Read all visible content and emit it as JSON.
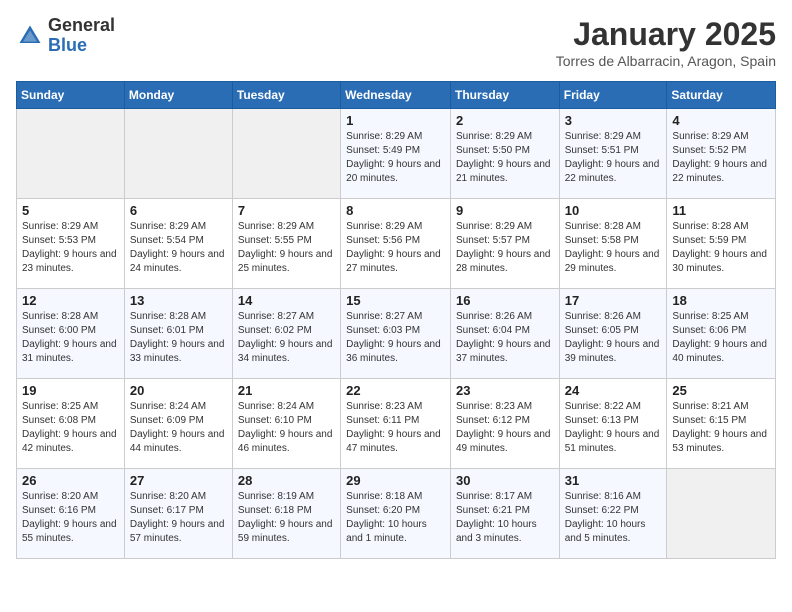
{
  "logo": {
    "general": "General",
    "blue": "Blue"
  },
  "header": {
    "month": "January 2025",
    "location": "Torres de Albarracin, Aragon, Spain"
  },
  "weekdays": [
    "Sunday",
    "Monday",
    "Tuesday",
    "Wednesday",
    "Thursday",
    "Friday",
    "Saturday"
  ],
  "weeks": [
    [
      {
        "day": "",
        "sunrise": "",
        "sunset": "",
        "daylight": "",
        "empty": true
      },
      {
        "day": "",
        "sunrise": "",
        "sunset": "",
        "daylight": "",
        "empty": true
      },
      {
        "day": "",
        "sunrise": "",
        "sunset": "",
        "daylight": "",
        "empty": true
      },
      {
        "day": "1",
        "sunrise": "Sunrise: 8:29 AM",
        "sunset": "Sunset: 5:49 PM",
        "daylight": "Daylight: 9 hours and 20 minutes."
      },
      {
        "day": "2",
        "sunrise": "Sunrise: 8:29 AM",
        "sunset": "Sunset: 5:50 PM",
        "daylight": "Daylight: 9 hours and 21 minutes."
      },
      {
        "day": "3",
        "sunrise": "Sunrise: 8:29 AM",
        "sunset": "Sunset: 5:51 PM",
        "daylight": "Daylight: 9 hours and 22 minutes."
      },
      {
        "day": "4",
        "sunrise": "Sunrise: 8:29 AM",
        "sunset": "Sunset: 5:52 PM",
        "daylight": "Daylight: 9 hours and 22 minutes."
      }
    ],
    [
      {
        "day": "5",
        "sunrise": "Sunrise: 8:29 AM",
        "sunset": "Sunset: 5:53 PM",
        "daylight": "Daylight: 9 hours and 23 minutes."
      },
      {
        "day": "6",
        "sunrise": "Sunrise: 8:29 AM",
        "sunset": "Sunset: 5:54 PM",
        "daylight": "Daylight: 9 hours and 24 minutes."
      },
      {
        "day": "7",
        "sunrise": "Sunrise: 8:29 AM",
        "sunset": "Sunset: 5:55 PM",
        "daylight": "Daylight: 9 hours and 25 minutes."
      },
      {
        "day": "8",
        "sunrise": "Sunrise: 8:29 AM",
        "sunset": "Sunset: 5:56 PM",
        "daylight": "Daylight: 9 hours and 27 minutes."
      },
      {
        "day": "9",
        "sunrise": "Sunrise: 8:29 AM",
        "sunset": "Sunset: 5:57 PM",
        "daylight": "Daylight: 9 hours and 28 minutes."
      },
      {
        "day": "10",
        "sunrise": "Sunrise: 8:28 AM",
        "sunset": "Sunset: 5:58 PM",
        "daylight": "Daylight: 9 hours and 29 minutes."
      },
      {
        "day": "11",
        "sunrise": "Sunrise: 8:28 AM",
        "sunset": "Sunset: 5:59 PM",
        "daylight": "Daylight: 9 hours and 30 minutes."
      }
    ],
    [
      {
        "day": "12",
        "sunrise": "Sunrise: 8:28 AM",
        "sunset": "Sunset: 6:00 PM",
        "daylight": "Daylight: 9 hours and 31 minutes."
      },
      {
        "day": "13",
        "sunrise": "Sunrise: 8:28 AM",
        "sunset": "Sunset: 6:01 PM",
        "daylight": "Daylight: 9 hours and 33 minutes."
      },
      {
        "day": "14",
        "sunrise": "Sunrise: 8:27 AM",
        "sunset": "Sunset: 6:02 PM",
        "daylight": "Daylight: 9 hours and 34 minutes."
      },
      {
        "day": "15",
        "sunrise": "Sunrise: 8:27 AM",
        "sunset": "Sunset: 6:03 PM",
        "daylight": "Daylight: 9 hours and 36 minutes."
      },
      {
        "day": "16",
        "sunrise": "Sunrise: 8:26 AM",
        "sunset": "Sunset: 6:04 PM",
        "daylight": "Daylight: 9 hours and 37 minutes."
      },
      {
        "day": "17",
        "sunrise": "Sunrise: 8:26 AM",
        "sunset": "Sunset: 6:05 PM",
        "daylight": "Daylight: 9 hours and 39 minutes."
      },
      {
        "day": "18",
        "sunrise": "Sunrise: 8:25 AM",
        "sunset": "Sunset: 6:06 PM",
        "daylight": "Daylight: 9 hours and 40 minutes."
      }
    ],
    [
      {
        "day": "19",
        "sunrise": "Sunrise: 8:25 AM",
        "sunset": "Sunset: 6:08 PM",
        "daylight": "Daylight: 9 hours and 42 minutes."
      },
      {
        "day": "20",
        "sunrise": "Sunrise: 8:24 AM",
        "sunset": "Sunset: 6:09 PM",
        "daylight": "Daylight: 9 hours and 44 minutes."
      },
      {
        "day": "21",
        "sunrise": "Sunrise: 8:24 AM",
        "sunset": "Sunset: 6:10 PM",
        "daylight": "Daylight: 9 hours and 46 minutes."
      },
      {
        "day": "22",
        "sunrise": "Sunrise: 8:23 AM",
        "sunset": "Sunset: 6:11 PM",
        "daylight": "Daylight: 9 hours and 47 minutes."
      },
      {
        "day": "23",
        "sunrise": "Sunrise: 8:23 AM",
        "sunset": "Sunset: 6:12 PM",
        "daylight": "Daylight: 9 hours and 49 minutes."
      },
      {
        "day": "24",
        "sunrise": "Sunrise: 8:22 AM",
        "sunset": "Sunset: 6:13 PM",
        "daylight": "Daylight: 9 hours and 51 minutes."
      },
      {
        "day": "25",
        "sunrise": "Sunrise: 8:21 AM",
        "sunset": "Sunset: 6:15 PM",
        "daylight": "Daylight: 9 hours and 53 minutes."
      }
    ],
    [
      {
        "day": "26",
        "sunrise": "Sunrise: 8:20 AM",
        "sunset": "Sunset: 6:16 PM",
        "daylight": "Daylight: 9 hours and 55 minutes."
      },
      {
        "day": "27",
        "sunrise": "Sunrise: 8:20 AM",
        "sunset": "Sunset: 6:17 PM",
        "daylight": "Daylight: 9 hours and 57 minutes."
      },
      {
        "day": "28",
        "sunrise": "Sunrise: 8:19 AM",
        "sunset": "Sunset: 6:18 PM",
        "daylight": "Daylight: 9 hours and 59 minutes."
      },
      {
        "day": "29",
        "sunrise": "Sunrise: 8:18 AM",
        "sunset": "Sunset: 6:20 PM",
        "daylight": "Daylight: 10 hours and 1 minute."
      },
      {
        "day": "30",
        "sunrise": "Sunrise: 8:17 AM",
        "sunset": "Sunset: 6:21 PM",
        "daylight": "Daylight: 10 hours and 3 minutes."
      },
      {
        "day": "31",
        "sunrise": "Sunrise: 8:16 AM",
        "sunset": "Sunset: 6:22 PM",
        "daylight": "Daylight: 10 hours and 5 minutes."
      },
      {
        "day": "",
        "sunrise": "",
        "sunset": "",
        "daylight": "",
        "empty": true
      }
    ]
  ]
}
